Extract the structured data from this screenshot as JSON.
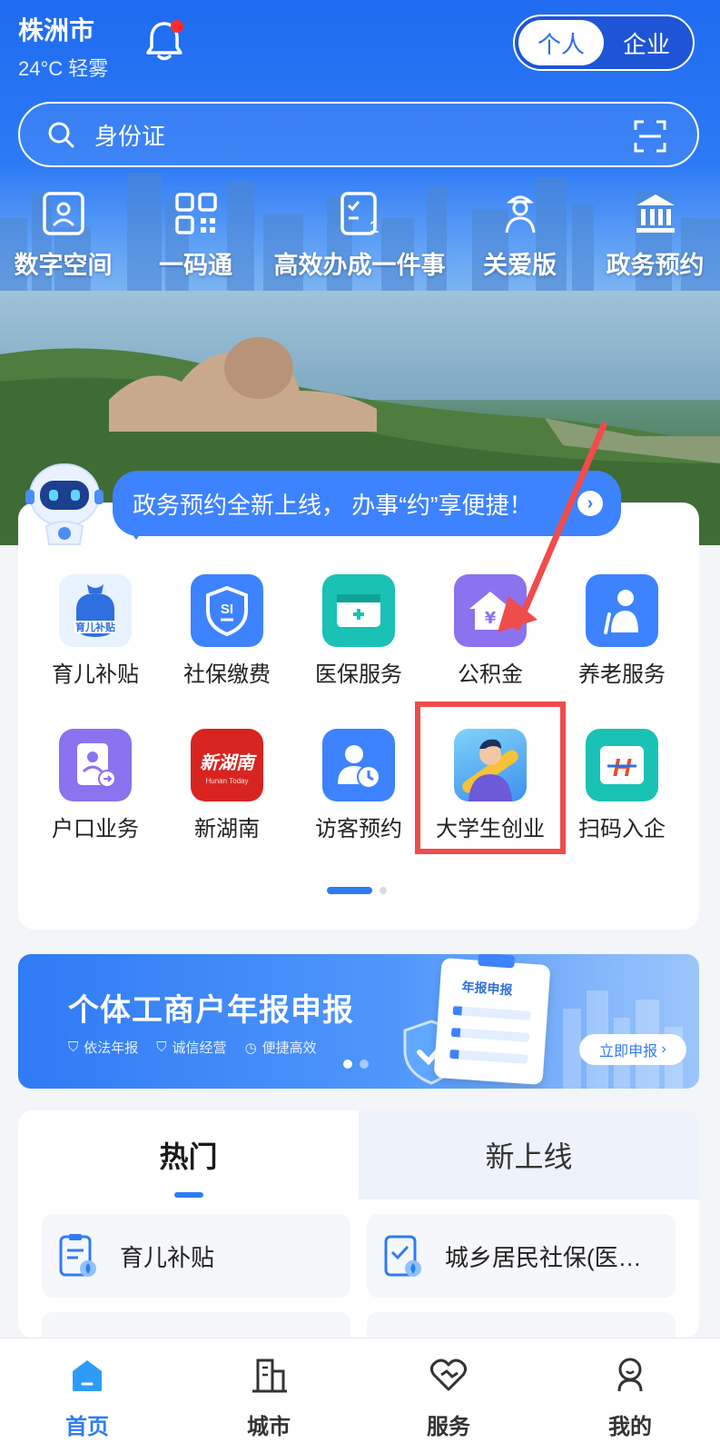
{
  "header": {
    "city": "株洲市",
    "weather": "24°C 轻雾",
    "switch": {
      "personal": "个人",
      "enterprise": "企业",
      "active": "personal"
    }
  },
  "search": {
    "placeholder": "身份证"
  },
  "quick_links": [
    {
      "label": "数字空间",
      "icon": "id-card-icon"
    },
    {
      "label": "一码通",
      "icon": "qr-code-icon"
    },
    {
      "label": "高效办成一件事",
      "icon": "checklist-icon"
    },
    {
      "label": "关爱版",
      "icon": "elder-care-icon"
    },
    {
      "label": "政务预约",
      "icon": "government-building-icon"
    }
  ],
  "notice": {
    "text": "政务预约全新上线， 办事“约”享便捷！"
  },
  "services_row1": [
    {
      "label": "育儿补贴",
      "icon": "childcare-subsidy-icon",
      "color": "#e9f2ff",
      "badge": "育儿补贴"
    },
    {
      "label": "社保缴费",
      "icon": "social-security-icon",
      "color": "#3d82ff",
      "badge": "SI"
    },
    {
      "label": "医保服务",
      "icon": "medical-insurance-icon",
      "color": "#19c2b4"
    },
    {
      "label": "公积金",
      "icon": "housing-fund-icon",
      "color": "#8b72ef",
      "badge": "¥"
    },
    {
      "label": "养老服务",
      "icon": "elderly-service-icon",
      "color": "#3d82ff"
    }
  ],
  "services_row2": [
    {
      "label": "户口业务",
      "icon": "household-registration-icon",
      "color": "#8b72ef"
    },
    {
      "label": "新湖南",
      "icon": "new-hunan-icon",
      "color": "#d8241f",
      "badge": "新湖南",
      "sub": "Hunan Today"
    },
    {
      "label": "访客预约",
      "icon": "visitor-appointment-icon",
      "color": "#3d82ff"
    },
    {
      "label": "大学生创业",
      "icon": "student-startup-icon",
      "color": "#4aa6f5"
    },
    {
      "label": "扫码入企",
      "icon": "scan-enterprise-icon",
      "color": "#19c2b4",
      "badge": "H"
    }
  ],
  "promo": {
    "title": "个体工商户年报申报",
    "tags": [
      "依法年报",
      "诚信经营",
      "便捷高效"
    ],
    "button": "立即申报",
    "doc_label": "年报申报"
  },
  "tabs": {
    "hot": "热门",
    "new": "新上线",
    "active": "hot"
  },
  "hot_items": [
    {
      "label": "育儿补贴",
      "icon": "childcare-doc-icon"
    },
    {
      "label": "城乡居民社保(医…",
      "icon": "insurance-doc-icon"
    }
  ],
  "bottom_nav": [
    {
      "label": "首页",
      "icon": "home-icon",
      "active": true
    },
    {
      "label": "城市",
      "icon": "city-icon",
      "active": false
    },
    {
      "label": "服务",
      "icon": "service-heart-icon",
      "active": false
    },
    {
      "label": "我的",
      "icon": "profile-icon",
      "active": false
    }
  ],
  "colors": {
    "brand": "#2f7bf5",
    "highlight": "#f04c4c",
    "notice": "#3d82ff"
  }
}
